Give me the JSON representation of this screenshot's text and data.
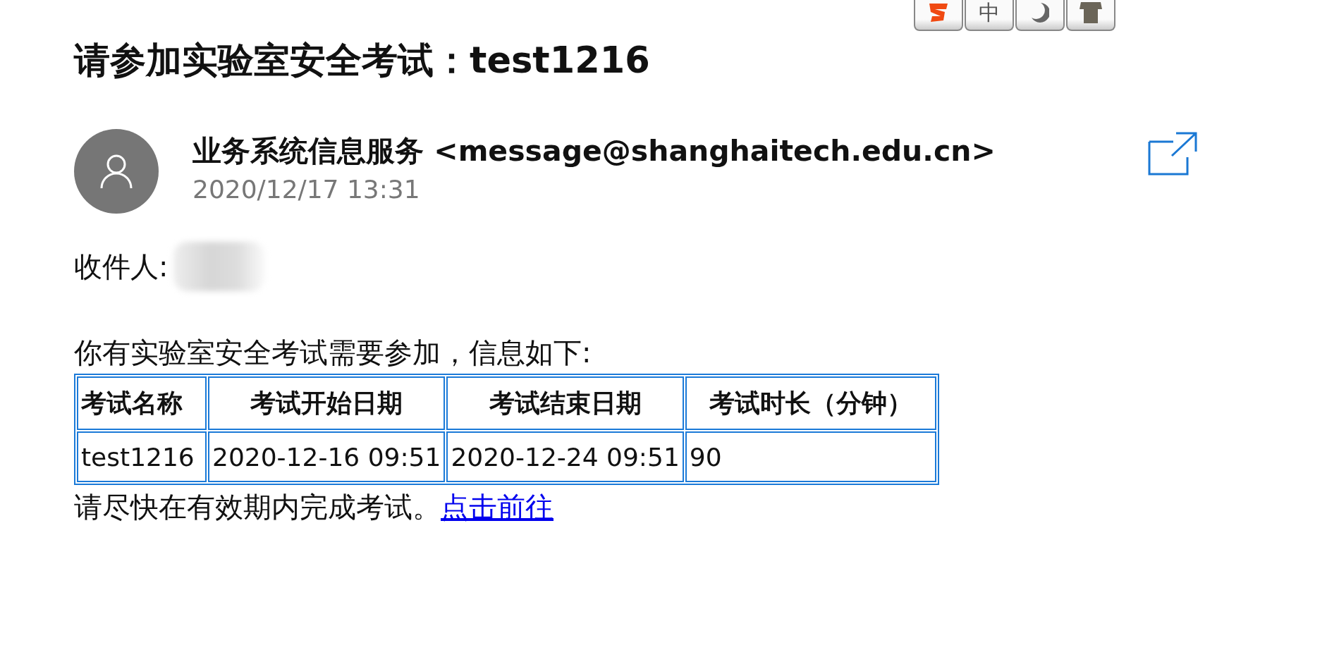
{
  "toolbar": [
    {
      "kind": "s-logo"
    },
    {
      "kind": "text",
      "label": "中"
    },
    {
      "kind": "moon"
    },
    {
      "kind": "shirt"
    }
  ],
  "subject": "请参加实验室安全考试：test1216",
  "sender": {
    "name": "业务系统信息服务 <message@shanghaitech.edu.cn>",
    "date": "2020/12/17 13:31"
  },
  "recipient": {
    "label": "收件人:"
  },
  "intro": "你有实验室安全考试需要参加，信息如下:",
  "table": {
    "columns": [
      "考试名称",
      "考试开始日期",
      "考试结束日期",
      "考试时长（分钟）"
    ],
    "rows": [
      [
        "test1216",
        "2020-12-16 09:51",
        "2020-12-24 09:51",
        "90"
      ]
    ]
  },
  "footer": {
    "text": "请尽快在有效期内完成考试。",
    "link": "点击前往"
  }
}
